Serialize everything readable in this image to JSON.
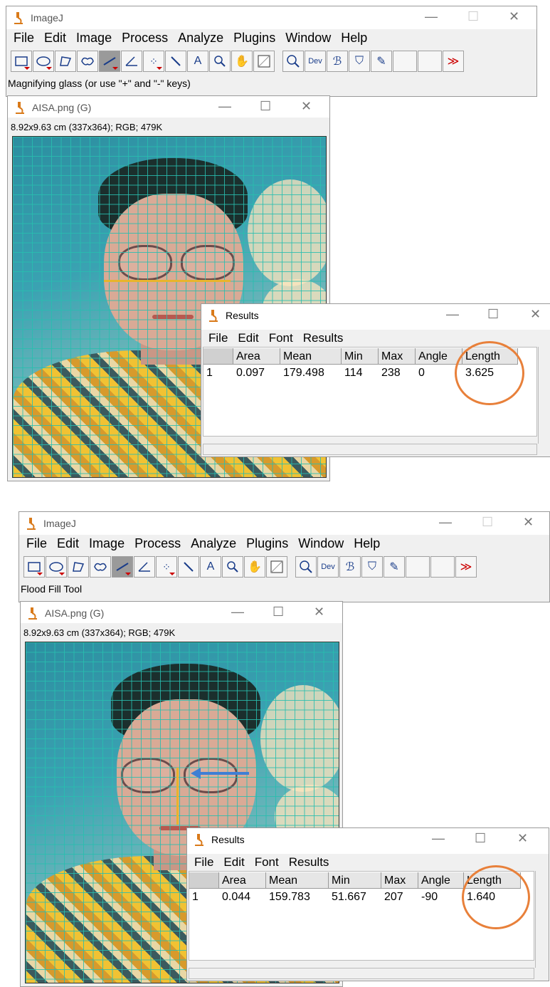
{
  "panels": [
    {
      "imagej": {
        "title": "ImageJ",
        "menu": [
          "File",
          "Edit",
          "Image",
          "Process",
          "Analyze",
          "Plugins",
          "Window",
          "Help"
        ],
        "status": "Magnifying glass (or use \"+\" and \"-\" keys)"
      },
      "image_window": {
        "title": "AISA.png (G)",
        "info": "8.92x9.63 cm (337x364); RGB; 479K"
      },
      "results": {
        "title": "Results",
        "menu": [
          "File",
          "Edit",
          "Font",
          "Results"
        ],
        "headers": [
          "",
          "Area",
          "Mean",
          "Min",
          "Max",
          "Angle",
          "Length"
        ],
        "row": [
          "1",
          "0.097",
          "179.498",
          "114",
          "238",
          "0",
          "3.625"
        ]
      }
    },
    {
      "imagej": {
        "title": "ImageJ",
        "menu": [
          "File",
          "Edit",
          "Image",
          "Process",
          "Analyze",
          "Plugins",
          "Window",
          "Help"
        ],
        "status": "Flood Fill Tool"
      },
      "image_window": {
        "title": "AISA.png (G)",
        "info": "8.92x9.63 cm (337x364); RGB; 479K"
      },
      "results": {
        "title": "Results",
        "menu": [
          "File",
          "Edit",
          "Font",
          "Results"
        ],
        "headers": [
          "",
          "Area",
          "Mean",
          "Min",
          "Max",
          "Angle",
          "Length"
        ],
        "row": [
          "1",
          "0.044",
          "159.783",
          "51.667",
          "207",
          "-90",
          "1.640"
        ]
      }
    }
  ],
  "toolbar": {
    "tools": [
      "rectangle-icon",
      "oval-icon",
      "polygon-icon",
      "freehand-icon",
      "line-icon",
      "angle-icon",
      "multipoint-icon",
      "wand-icon",
      "text-icon",
      "magnifier-icon",
      "hand-icon",
      "color-picker-icon",
      "zoom-icon",
      "dev-icon",
      "brush-icon",
      "flood-fill-icon",
      "pencil-icon",
      "more-tools-icon"
    ],
    "text_tool": "A",
    "dev_tool": "Dev",
    "more_tools": "≫"
  },
  "colors": {
    "highlight_circle": "#e8803a",
    "grid": "#28beaf",
    "active_tool": "#9a9a9a",
    "arrow": "#3f7fd4"
  }
}
